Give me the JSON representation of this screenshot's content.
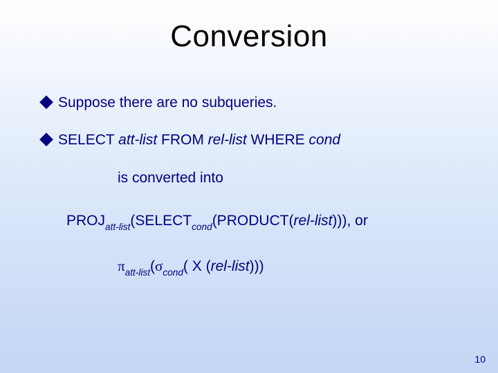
{
  "title": "Conversion",
  "bullets": [
    {
      "segments": [
        {
          "t": "Suppose there are no subqueries."
        }
      ]
    },
    {
      "segments": [
        {
          "t": "SELECT "
        },
        {
          "t": "att-list",
          "italic": true
        },
        {
          "t": " FROM "
        },
        {
          "t": "rel-list",
          "italic": true
        },
        {
          "t": " WHERE "
        },
        {
          "t": "cond",
          "italic": true
        }
      ]
    }
  ],
  "lines": [
    {
      "indent": "indent1",
      "segments": [
        {
          "t": "is converted into"
        }
      ]
    },
    {
      "indent": "indent2",
      "segments": [
        {
          "t": "PROJ"
        },
        {
          "t": "att-list",
          "cls": "sub italic"
        },
        {
          "t": "(SELECT"
        },
        {
          "t": "cond",
          "cls": "sub italic"
        },
        {
          "t": "(PRODUCT("
        },
        {
          "t": "rel-list",
          "cls": "italic"
        },
        {
          "t": "))), or"
        }
      ]
    },
    {
      "indent": "indent3",
      "segments": [
        {
          "t": "π",
          "cls": "sym"
        },
        {
          "t": "att-list",
          "cls": "sub italic"
        },
        {
          "t": "("
        },
        {
          "t": "σ",
          "cls": "sym"
        },
        {
          "t": "cond",
          "cls": "sub italic"
        },
        {
          "t": "( X ("
        },
        {
          "t": "rel-list",
          "cls": "italic"
        },
        {
          "t": ")))"
        }
      ]
    }
  ],
  "pageNumber": "10"
}
